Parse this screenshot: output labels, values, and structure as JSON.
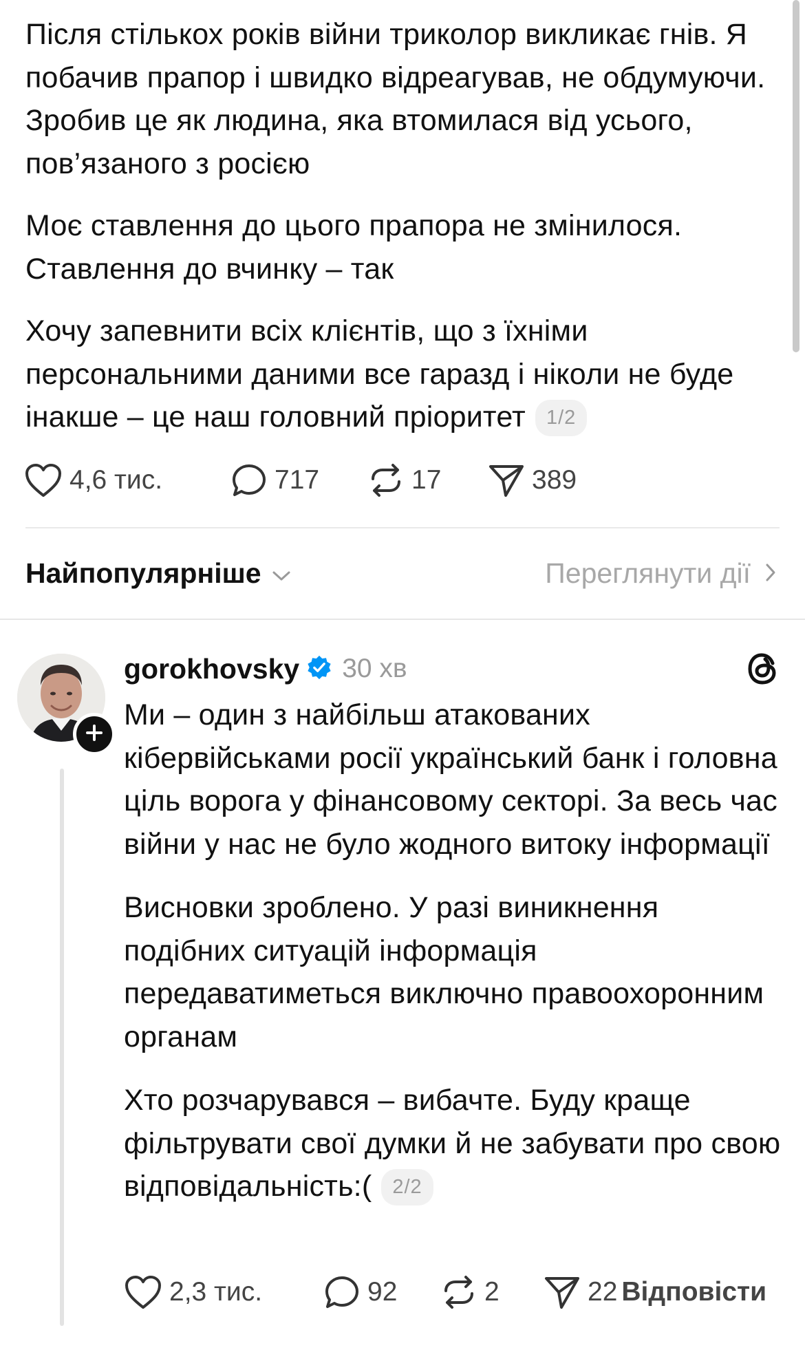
{
  "top_post": {
    "paragraphs": [
      "Після стількох років війни триколор викликає гнів. Я побачив прапор і швидко відреагував, не обдумуючи. Зробив це як людина, яка втомилася від усього, пов’язаного з росією",
      "Моє ставлення до цього прапора не змінилося. Ставлення до вчинку – так",
      "Хочу запевнити всіх клієнтів, що з їхніми персональними даними все гаразд і ніколи не буде інакше – це наш головний пріоритет"
    ],
    "counter": "1/2",
    "likes": "4,6 тис.",
    "comments": "717",
    "reposts": "17",
    "shares": "389"
  },
  "sort_bar": {
    "label": "Найпопулярніше",
    "view_activity": "Переглянути дії"
  },
  "reply": {
    "username": "gorokhovsky",
    "time": "30 хв",
    "paragraphs": [
      "Ми – один з найбільш атакованих кібервійськами росії український банк і головна ціль ворога у фінансовому секторі. За весь час війни у нас не було жодного витоку інформації",
      "Висновки зроблено. У разі виникнення подібних ситуацій інформація передаватиметься виключно правоохоронним органам",
      "Хто розчарувався – вибачте. Буду краще фільтрувати свої думки й не забувати про свою відповідальність:("
    ],
    "counter": "2/2",
    "likes": "2,3 тис.",
    "comments": "92",
    "reposts": "2",
    "shares": "22",
    "reply_label": "Відповісти"
  },
  "icons": {
    "like": "heart-icon",
    "comment": "comment-bubble-icon",
    "repost": "repost-arrows-icon",
    "share": "send-paper-plane-icon",
    "verified": "verified-badge-icon",
    "threads": "threads-logo-icon",
    "follow": "plus-icon",
    "chevron_down": "chevron-down-icon",
    "chevron_right": "chevron-right-icon"
  },
  "colors": {
    "text": "#111111",
    "muted": "#9a9a9a",
    "verified_blue": "#0095f6",
    "divider": "#e9e9e9"
  }
}
